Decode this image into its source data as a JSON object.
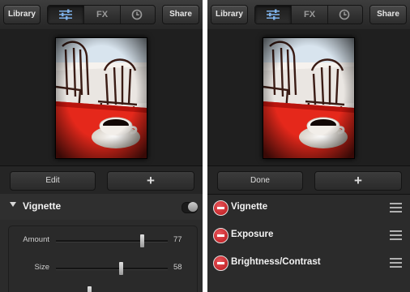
{
  "left": {
    "toolbar": {
      "library": "Library",
      "fx": "FX",
      "share": "Share"
    },
    "actions": {
      "primary": "Edit",
      "add": "+"
    },
    "vignette": {
      "title": "Vignette",
      "sliders": [
        {
          "label": "Amount",
          "value": "77",
          "level": 0.77
        },
        {
          "label": "Size",
          "value": "58",
          "level": 0.58
        },
        {
          "label": "",
          "value": "",
          "level": 0.3
        }
      ]
    }
  },
  "right": {
    "toolbar": {
      "library": "Library",
      "fx": "FX",
      "share": "Share"
    },
    "actions": {
      "primary": "Done",
      "add": "+"
    },
    "adjustments": [
      "Vignette",
      "Exposure",
      "Brightness/Contrast"
    ]
  }
}
